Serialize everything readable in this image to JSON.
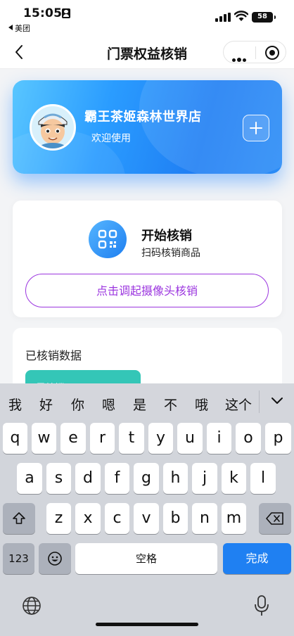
{
  "status_bar": {
    "time": "15:05",
    "back_app": "美团",
    "battery": "58"
  },
  "nav": {
    "title": "门票权益核销"
  },
  "store": {
    "name": "霸王茶姬森林世界店",
    "welcome": "欢迎使用",
    "add_icon": "plus-icon"
  },
  "scan": {
    "title": "开始核销",
    "subtitle": "扫码核销商品",
    "camera_button": "点击调起摄像头核销",
    "icon": "qr-code-icon"
  },
  "stats": {
    "title": "已核销数据",
    "chip_label": "已核销"
  },
  "keyboard": {
    "candidates": [
      "我",
      "好",
      "你",
      "嗯",
      "是",
      "不",
      "哦",
      "这个"
    ],
    "row1": [
      "q",
      "w",
      "e",
      "r",
      "t",
      "y",
      "u",
      "i",
      "o",
      "p"
    ],
    "row2": [
      "a",
      "s",
      "d",
      "f",
      "g",
      "h",
      "j",
      "k",
      "l"
    ],
    "row3": [
      "z",
      "x",
      "c",
      "v",
      "b",
      "n",
      "m"
    ],
    "numbers_label": "123",
    "space_label": "空格",
    "done_label": "完成"
  },
  "colors": {
    "accent_purple": "#9b35df",
    "brand_blue": "#1f80f2",
    "chip_teal": "#34c6b7"
  }
}
